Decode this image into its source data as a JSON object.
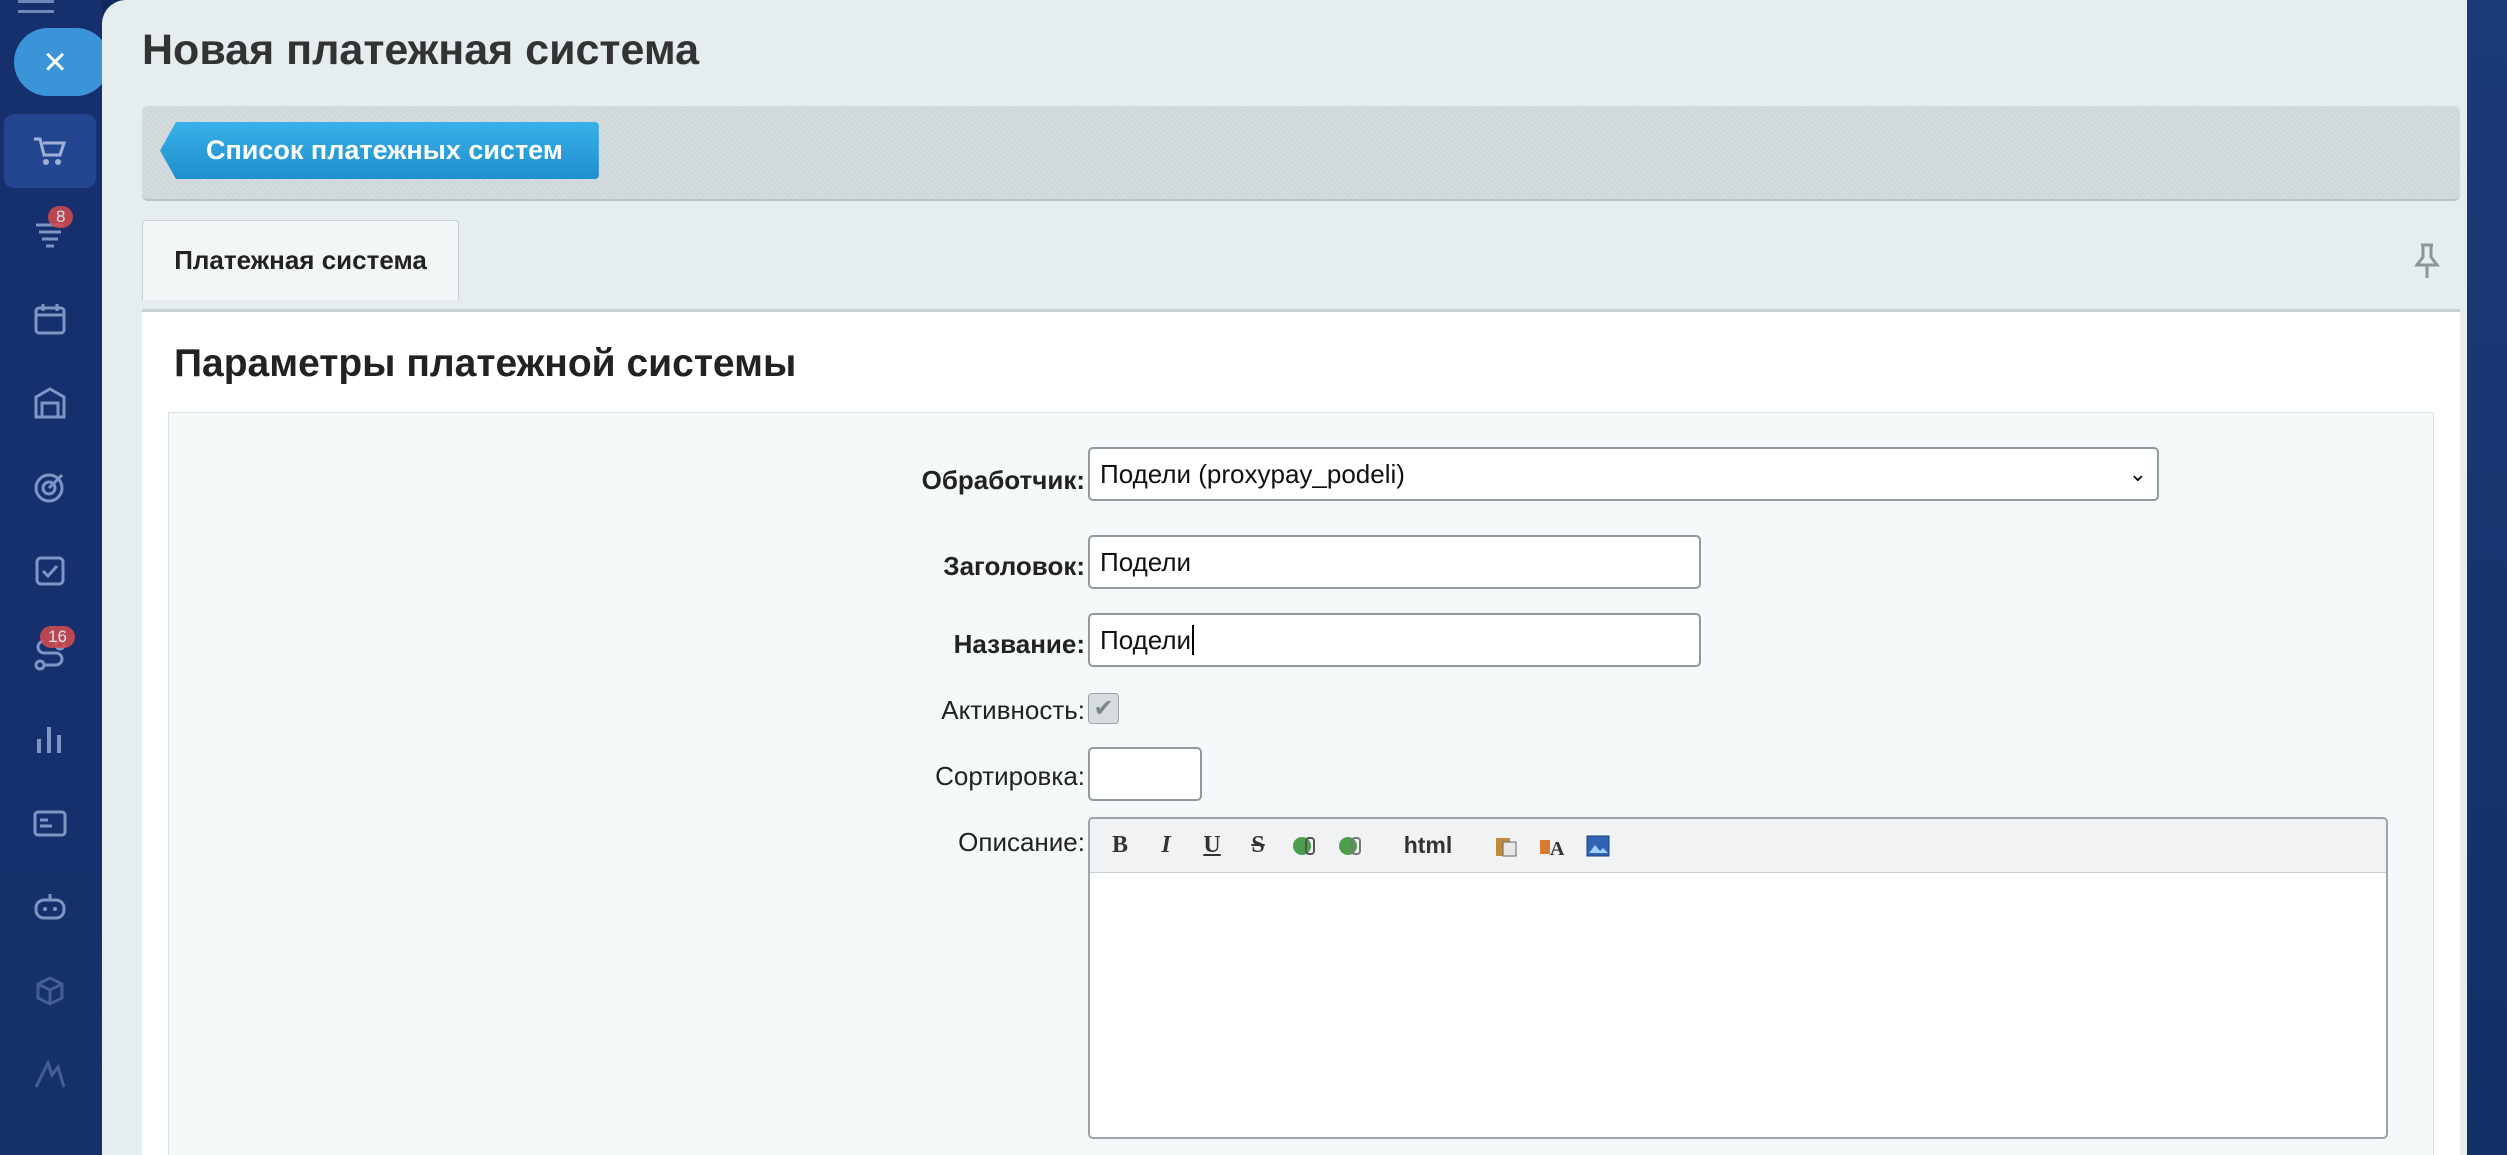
{
  "page": {
    "title": "Новая платежная система"
  },
  "toolbar": {
    "back_label": "Список платежных систем"
  },
  "tabs": [
    {
      "label": "Платежная система"
    }
  ],
  "section": {
    "title": "Параметры платежной системы"
  },
  "form": {
    "handler_label": "Обработчик:",
    "handler_value": "Подели (proxypay_podeli)",
    "header_label": "Заголовок:",
    "header_value": "Подели",
    "name_label": "Название:",
    "name_value": "Подели",
    "active_label": "Активность:",
    "active_checked": true,
    "sort_label": "Сортировка:",
    "sort_value": "",
    "description_label": "Описание:",
    "editor_html_label": "html"
  },
  "sidebar": {
    "badges": {
      "notifications": "8",
      "workflows": "16"
    },
    "items": [
      "cart-icon",
      "funnel-icon",
      "calendar-icon",
      "store-icon",
      "target-icon",
      "checkbox-icon",
      "route-icon",
      "chart-icon",
      "id-card-icon",
      "robot-icon",
      "box-icon",
      "logo-icon"
    ]
  },
  "colors": {
    "sidebar_bg": "#15306d",
    "accent": "#3b93d8",
    "back_button": "#2a9fdc",
    "badge": "#d64b4b",
    "panel_bg": "#e5edef"
  }
}
